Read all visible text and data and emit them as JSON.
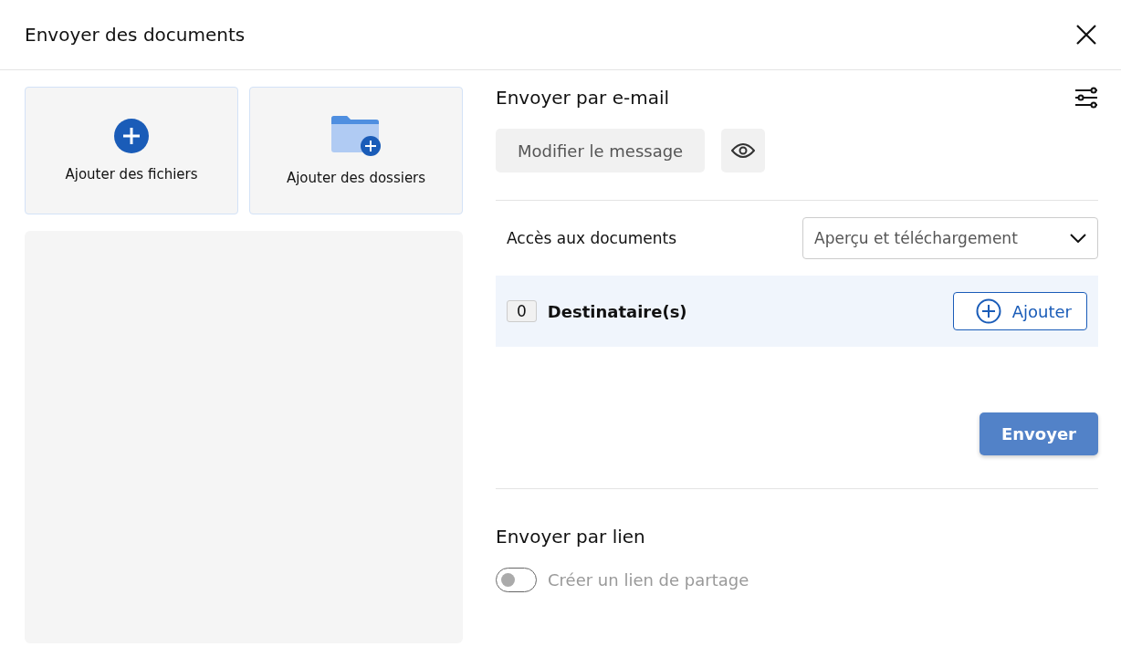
{
  "window": {
    "title": "Envoyer des documents"
  },
  "add_tiles": [
    {
      "kind": "files",
      "label": "Ajouter des fichiers"
    },
    {
      "kind": "folders",
      "label": "Ajouter des dossiers"
    }
  ],
  "email": {
    "title": "Envoyer par e-mail",
    "edit_button": "Modifier le message",
    "access": {
      "label": "Accès aux documents",
      "value": "Aperçu et téléchargement"
    },
    "recipients": {
      "count": "0",
      "label": "Destinataire(s)",
      "add_button": "Ajouter"
    },
    "send_button": {
      "label": "Envoyer",
      "disabled": true
    }
  },
  "link": {
    "title": "Envoyer par lien",
    "toggle": {
      "label": "Créer un lien de partage",
      "on": false,
      "disabled": true
    }
  }
}
